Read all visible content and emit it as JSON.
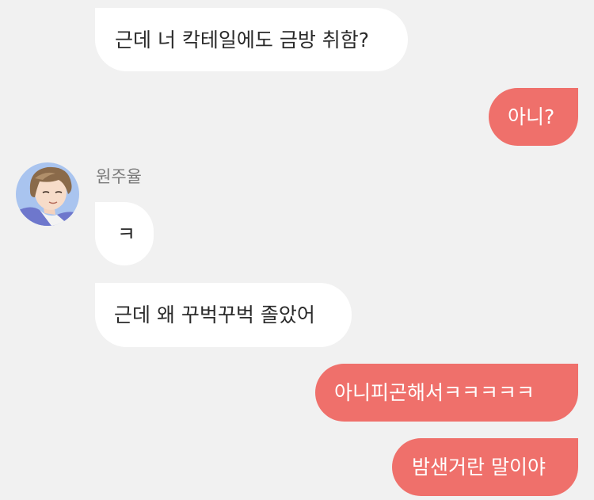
{
  "chat": {
    "sender_name": "원주율",
    "avatar_icon": "avatar-portrait",
    "colors": {
      "background": "#f1f1f1",
      "incoming_bubble": "#ffffff",
      "outgoing_bubble": "#ef706b",
      "incoming_text": "#2a2a2a",
      "outgoing_text": "#ffffff"
    },
    "messages": [
      {
        "direction": "incoming",
        "text": "근데 너 칵테일에도 금방 취함?"
      },
      {
        "direction": "outgoing",
        "text": "아니?"
      },
      {
        "direction": "incoming",
        "text": "ㅋ"
      },
      {
        "direction": "incoming",
        "text": "근데 왜 꾸벅꾸벅 졸았어"
      },
      {
        "direction": "outgoing",
        "text": "아니피곤해서ㅋㅋㅋㅋㅋ"
      },
      {
        "direction": "outgoing",
        "text": "밤샌거란 말이야"
      }
    ]
  }
}
